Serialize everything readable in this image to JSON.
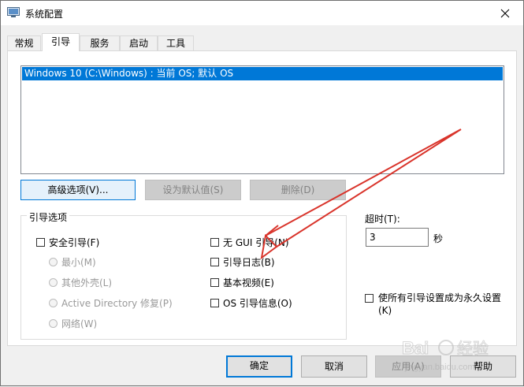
{
  "window": {
    "title": "系统配置"
  },
  "tabs": [
    {
      "label": "常规"
    },
    {
      "label": "引导"
    },
    {
      "label": "服务"
    },
    {
      "label": "启动"
    },
    {
      "label": "工具"
    }
  ],
  "boot_list": {
    "entries": [
      "Windows 10 (C:\\Windows) : 当前 OS; 默认 OS"
    ]
  },
  "buttons": {
    "advanced": "高级选项(V)...",
    "set_default": "设为默认值(S)",
    "delete": "删除(D)"
  },
  "boot_options": {
    "legend": "引导选项",
    "safe_boot": "安全引导(F)",
    "radios": [
      "最小(M)",
      "其他外壳(L)",
      "Active Directory 修复(P)",
      "网络(W)"
    ],
    "right_checks": [
      "无 GUI 引导(N)",
      "引导日志(B)",
      "基本视频(E)",
      "OS 引导信息(O)"
    ]
  },
  "timeout": {
    "label": "超时(T):",
    "value": "3",
    "unit": "秒"
  },
  "permanent": "使所有引导设置成为永久设置(K)",
  "footer": {
    "ok": "确定",
    "cancel": "取消",
    "apply": "应用(A)",
    "help": "帮助"
  },
  "watermark": {
    "brand": "Bai",
    "brand_suffix": "经验",
    "url": "jingyan.baidu.com"
  }
}
